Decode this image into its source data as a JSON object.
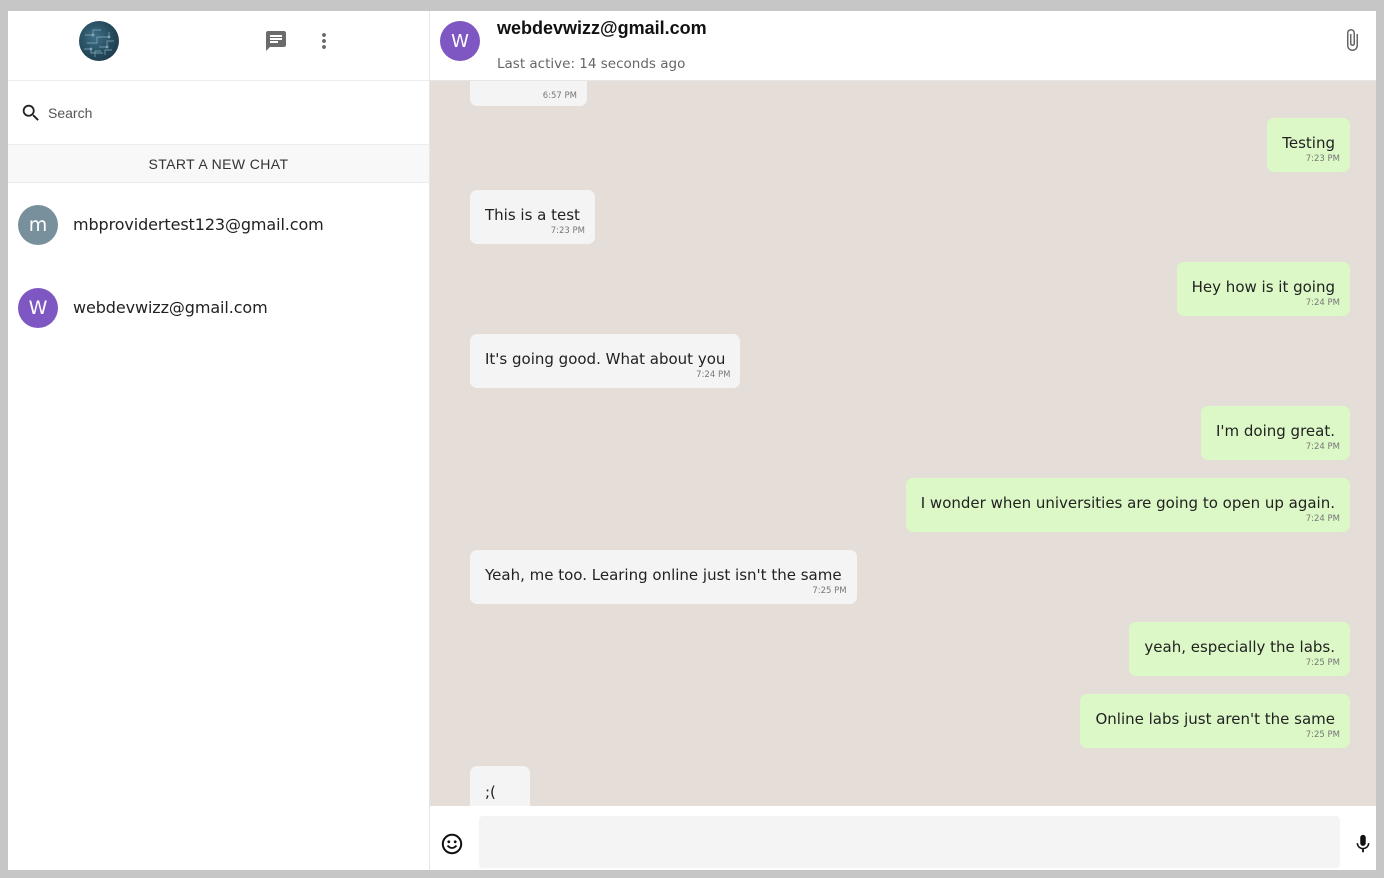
{
  "sidebar": {
    "search_placeholder": "Search",
    "new_chat_label": "START A NEW CHAT",
    "contacts": [
      {
        "initial": "m",
        "email": "mbprovidertest123@gmail.com",
        "color": "#78909c"
      },
      {
        "initial": "W",
        "email": "webdevwizz@gmail.com",
        "color": "#7e57c2"
      }
    ]
  },
  "chat": {
    "avatar_initial": "W",
    "title": "webdevwizz@gmail.com",
    "last_active": "Last active: 14 seconds ago",
    "input_value": "",
    "messages": [
      {
        "dir": "in",
        "text": "",
        "time": "6:57 PM"
      },
      {
        "dir": "out",
        "text": "Testing",
        "time": "7:23 PM"
      },
      {
        "dir": "in",
        "text": "This is a test",
        "time": "7:23 PM"
      },
      {
        "dir": "out",
        "text": "Hey how is it going",
        "time": "7:24 PM"
      },
      {
        "dir": "in",
        "text": "It's going good. What about you",
        "time": "7:24 PM"
      },
      {
        "dir": "out",
        "text": "I'm doing great.",
        "time": "7:24 PM"
      },
      {
        "dir": "out",
        "text": "I wonder when universities are going to open up again.",
        "time": "7:24 PM"
      },
      {
        "dir": "in",
        "text": "Yeah, me too. Learing online just isn't the same",
        "time": "7:25 PM"
      },
      {
        "dir": "out",
        "text": "yeah, especially the labs.",
        "time": "7:25 PM"
      },
      {
        "dir": "out",
        "text": "Online labs just aren't the same",
        "time": "7:25 PM"
      },
      {
        "dir": "in",
        "text": ";(",
        "time": ""
      }
    ]
  },
  "colors": {
    "incoming_bubble": "#f4f4f4",
    "outgoing_bubble": "#dcf8c6",
    "chat_background": "#e5ddd8"
  },
  "icons": {
    "chat": "chat-icon",
    "menu": "more-vert-icon",
    "search": "search-icon",
    "attach": "paperclip-icon",
    "emoji": "emoji-icon",
    "mic": "mic-icon"
  }
}
